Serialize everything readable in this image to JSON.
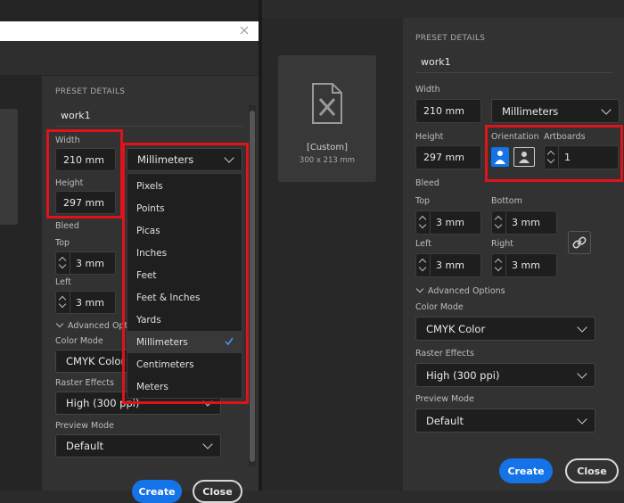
{
  "left": {
    "section_title": "PRESET DETAILS",
    "preset_name": "work1",
    "width_label": "Width",
    "width_value": "210 mm",
    "height_label": "Height",
    "height_value": "297 mm",
    "units_selected": "Millimeters",
    "units_options": [
      "Pixels",
      "Points",
      "Picas",
      "Inches",
      "Feet",
      "Feet & Inches",
      "Yards",
      "Millimeters",
      "Centimeters",
      "Meters"
    ],
    "bleed_label": "Bleed",
    "top_label": "Top",
    "top_value": "3 mm",
    "left_label": "Left",
    "left_value": "3 mm",
    "advanced_label": "Advanced Option",
    "color_mode_label": "Color Mode",
    "color_mode_value": "CMYK Color",
    "raster_label": "Raster Effects",
    "raster_value": "High (300 ppi)",
    "preview_label": "Preview Mode",
    "preview_value": "Default",
    "create_label": "Create",
    "close_label": "Close"
  },
  "right": {
    "thumb_title": "[Custom]",
    "thumb_size": "300 x 213 mm",
    "section_title": "PRESET DETAILS",
    "preset_name": "work1",
    "width_label": "Width",
    "width_value": "210 mm",
    "units_selected": "Millimeters",
    "height_label": "Height",
    "height_value": "297 mm",
    "orientation_label": "Orientation",
    "artboards_label": "Artboards",
    "artboards_value": "1",
    "bleed_label": "Bleed",
    "top_label": "Top",
    "top_value": "3 mm",
    "bottom_label": "Bottom",
    "bottom_value": "3 mm",
    "left_label": "Left",
    "left_value": "3 mm",
    "right_label": "Right",
    "right_value": "3 mm",
    "advanced_label": "Advanced Options",
    "color_mode_label": "Color Mode",
    "color_mode_value": "CMYK Color",
    "raster_label": "Raster Effects",
    "raster_value": "High (300 ppi)",
    "preview_label": "Preview Mode",
    "preview_value": "Default",
    "create_label": "Create",
    "close_label": "Close"
  },
  "colors": {
    "accent": "#1473e6",
    "highlight": "#e0131b",
    "panel": "#323232",
    "field": "#1e1e1e"
  }
}
